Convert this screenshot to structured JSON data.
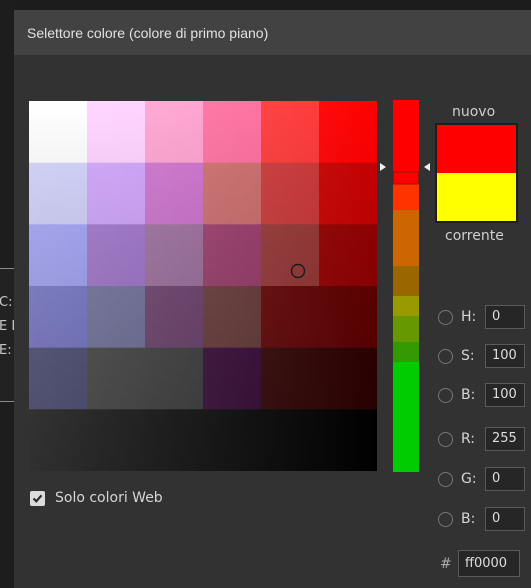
{
  "dialog": {
    "title": "Selettore colore (colore di primo piano)"
  },
  "behind_panel": {
    "fragments": [
      "C:",
      "E L",
      "E:"
    ]
  },
  "swatches": {
    "new_label": "nuovo",
    "current_label": "corrente",
    "new_color": "#ff0000",
    "current_color": "#ffff00"
  },
  "picker": {
    "web_only_label": "Solo colori Web",
    "web_only_checked": true
  },
  "fields": {
    "h": {
      "label": "H:",
      "value": "0"
    },
    "s": {
      "label": "S:",
      "value": "100"
    },
    "b_hsb": {
      "label": "B:",
      "value": "100"
    },
    "r": {
      "label": "R:",
      "value": "255"
    },
    "g": {
      "label": "G:",
      "value": "0"
    },
    "b_rgb": {
      "label": "B:",
      "value": "0"
    },
    "hex_symbol": "#",
    "hex": "ff0000"
  },
  "colors": {
    "dialog_bg": "#323232",
    "titlebar_bg": "#424242",
    "accent": "#ff0000"
  }
}
